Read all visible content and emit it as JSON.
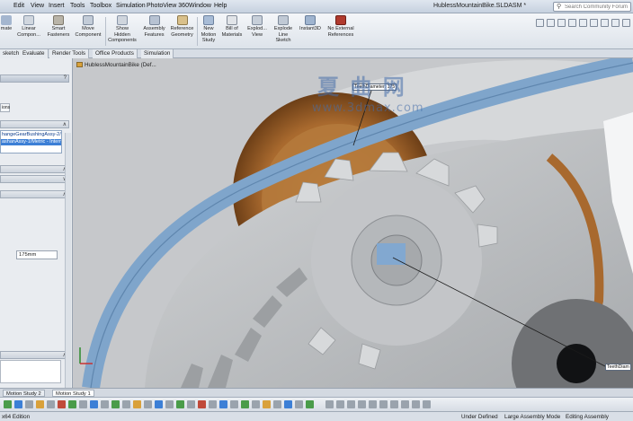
{
  "menubar": {
    "items": [
      "Edit",
      "View",
      "Insert",
      "Tools",
      "Toolbox",
      "Simulation",
      "PhotoView 360",
      "Window",
      "Help"
    ],
    "document_title": "HublessMountainBike.SLDASM *",
    "search_placeholder": "Search Community Forum"
  },
  "commandbar": {
    "commands": [
      {
        "label": "mate",
        "icon": "mate-icon"
      },
      {
        "label": "Linear Compon...",
        "icon": "linear-pattern-icon"
      },
      {
        "label": "Smart Fasteners",
        "icon": "smart-fasteners-icon"
      },
      {
        "label": "Move Component",
        "icon": "move-component-icon"
      },
      {
        "label": "Show Hidden Components",
        "icon": "show-hidden-icon"
      },
      {
        "label": "Assembly Features",
        "icon": "assembly-features-icon"
      },
      {
        "label": "Reference Geometry",
        "icon": "reference-geometry-icon"
      },
      {
        "label": "New Motion Study",
        "icon": "new-motion-study-icon"
      },
      {
        "label": "Bill of Materials",
        "icon": "bill-of-materials-icon"
      },
      {
        "label": "Explod... View",
        "icon": "exploded-view-icon"
      },
      {
        "label": "Explode Line Sketch",
        "icon": "explode-line-sketch-icon"
      },
      {
        "label": "Instant3D",
        "icon": "instant3d-icon"
      },
      {
        "label": "No External References",
        "icon": "no-external-references-icon"
      }
    ]
  },
  "tabs": [
    "sketch",
    "Evaluate",
    "Render Tools",
    "Office Products",
    "Simulation"
  ],
  "left_panel": {
    "help_button": "?",
    "sub_tab": "ions",
    "selections": [
      "hangeGearBushingAssy-2/P",
      "ashanAssy-1/Metric - Intern"
    ],
    "dimension_value": "175mm"
  },
  "viewport": {
    "tree_root": "HublessMountainBike (Def...",
    "dimension_labels": [
      "TeethDiameter: 175",
      "TeethDiam"
    ],
    "watermark": "夏 曲 网",
    "watermark_url": "www.3dmax.com"
  },
  "motion_tabs": [
    "Motion Study 2",
    "Motion Study 1"
  ],
  "statusbar": {
    "edition": "x64 Edition",
    "state": "Under Defined",
    "mode": "Large Assembly Mode",
    "editing": "Editing Assembly"
  },
  "colors": {
    "bronze": "#a8692e",
    "blue_ring": "#7fa5cb",
    "gear_gray": "#bfc1c4",
    "dark_gear": "#6f7174",
    "selection_blue": "#3c7fd6"
  }
}
